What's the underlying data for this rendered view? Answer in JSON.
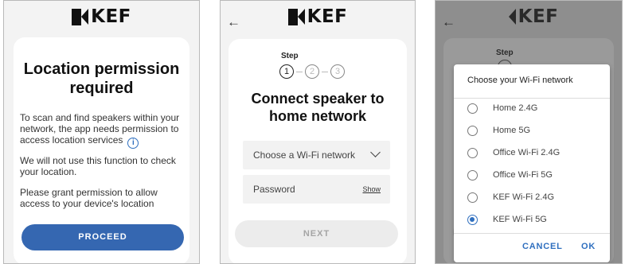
{
  "brand": {
    "logo_text": "KEF"
  },
  "screen1": {
    "title": "Location permission required",
    "para1": "To scan and find speakers within your network, the app needs permission to access location services",
    "para2": "We will not use this function to check your location.",
    "para3": "Please grant permission to allow access to your device's location",
    "proceed_label": "PROCEED"
  },
  "screen2": {
    "back_glyph": "←",
    "step_label": "Step",
    "steps": [
      "1",
      "2",
      "3"
    ],
    "title": "Connect speaker to home network",
    "wifi_placeholder": "Choose a Wi-Fi network",
    "password_placeholder": "Password",
    "show_label": "Show",
    "next_label": "NEXT"
  },
  "screen3": {
    "back_glyph": "←",
    "step_label": "Step",
    "dialog_title": "Choose your Wi-Fi network",
    "options": [
      {
        "label": "Home 2.4G",
        "selected": false
      },
      {
        "label": "Home 5G",
        "selected": false
      },
      {
        "label": "Office Wi-Fi 2.4G",
        "selected": false
      },
      {
        "label": "Office Wi-Fi 5G",
        "selected": false
      },
      {
        "label": "KEF Wi-Fi 2.4G",
        "selected": false
      },
      {
        "label": "KEF Wi-Fi 5G",
        "selected": true
      }
    ],
    "cancel_label": "CANCEL",
    "ok_label": "OK"
  },
  "colors": {
    "accent": "#3567b1",
    "link": "#2f6fbf",
    "overlay": "#8e8e8e"
  },
  "icons": [
    "kef-logo-icon",
    "back-arrow-icon",
    "info-icon",
    "chevron-down-icon",
    "radio-icon"
  ]
}
